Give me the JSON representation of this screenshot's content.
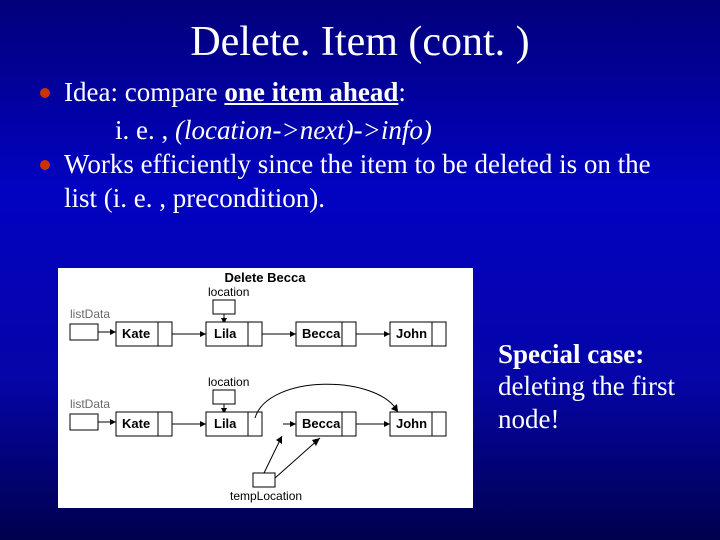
{
  "title": "Delete. Item (cont. )",
  "bullets": {
    "b1_prefix": "Idea: compare ",
    "b1_bold": "one item ahead",
    "b1_suffix": ":",
    "indent_prefix": "i. e. , ",
    "indent_italic": "(location->next)->info)",
    "b2": "Works efficiently since the item to be deleted is on the list  (i. e. , precondition)."
  },
  "special": {
    "bold": "Special case:",
    "rest": " deleting the first node!"
  },
  "diagram": {
    "caption": "Delete Becca",
    "listData": "listData",
    "location": "location",
    "location2": "location",
    "tempLocation": "tempLocation",
    "nodes": [
      "Kate",
      "Lila",
      "Becca",
      "John"
    ]
  }
}
